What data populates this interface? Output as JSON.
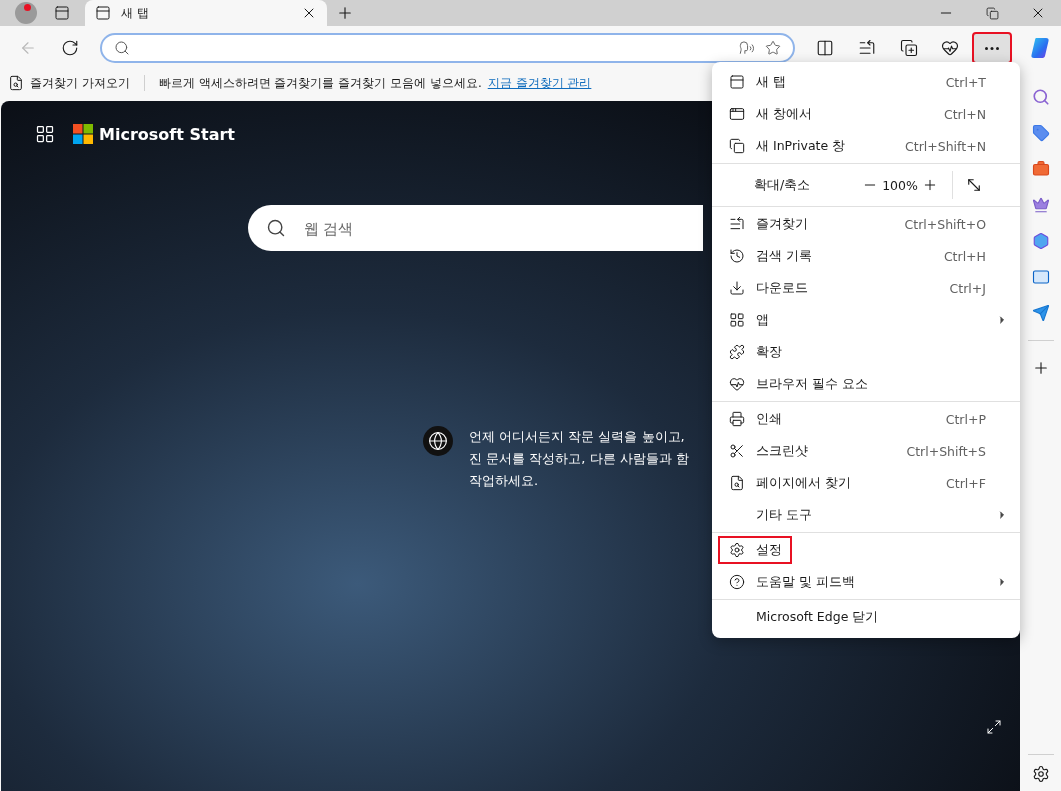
{
  "tabs": [
    {
      "title": "새 탭",
      "selected": true
    }
  ],
  "navigation": {
    "back_disabled": true
  },
  "more_button": {
    "highlighted": true
  },
  "favorites_bar": {
    "import_label": "즐겨찾기 가져오기",
    "message": "빠르게 액세스하려면 즐겨찾기를 즐겨찾기 모음에 넣으세요.",
    "link": "지금 즐겨찾기 관리"
  },
  "start_page": {
    "brand": "Microsoft Start",
    "search_placeholder": "웹 검색",
    "tagline_lines": [
      "언제 어디서든지 작문 실력을 높이고,",
      "진 문서를 작성하고, 다른 사람들과 함",
      "작업하세요."
    ]
  },
  "menu": {
    "groups": [
      [
        {
          "kind": "item",
          "label": "새 탭",
          "shortcut": "Ctrl+T",
          "submenu": false,
          "highlighted": false
        },
        {
          "kind": "item",
          "label": "새 창에서",
          "shortcut": "Ctrl+N",
          "submenu": false,
          "highlighted": false
        },
        {
          "kind": "item",
          "label": "새 InPrivate 창",
          "shortcut": "Ctrl+Shift+N",
          "submenu": false,
          "highlighted": false
        }
      ],
      [
        {
          "kind": "zoom",
          "label": "확대/축소",
          "value": "100%"
        }
      ],
      [
        {
          "kind": "item",
          "label": "즐겨찾기",
          "shortcut": "Ctrl+Shift+O",
          "submenu": false,
          "highlighted": false
        },
        {
          "kind": "item",
          "label": "검색 기록",
          "shortcut": "Ctrl+H",
          "submenu": false,
          "highlighted": false
        },
        {
          "kind": "item",
          "label": "다운로드",
          "shortcut": "Ctrl+J",
          "submenu": false,
          "highlighted": false
        },
        {
          "kind": "item",
          "label": "앱",
          "submenu": true,
          "highlighted": false
        },
        {
          "kind": "item",
          "label": "확장",
          "submenu": false,
          "highlighted": false
        },
        {
          "kind": "item",
          "label": "브라우저 필수 요소",
          "submenu": false,
          "highlighted": false
        }
      ],
      [
        {
          "kind": "item",
          "label": "인쇄",
          "shortcut": "Ctrl+P",
          "submenu": false,
          "highlighted": false
        },
        {
          "kind": "item",
          "label": "스크린샷",
          "shortcut": "Ctrl+Shift+S",
          "submenu": false,
          "highlighted": false
        },
        {
          "kind": "item",
          "label": "페이지에서 찾기",
          "shortcut": "Ctrl+F",
          "submenu": false,
          "highlighted": false
        },
        {
          "kind": "item",
          "label": "기타 도구",
          "submenu": true,
          "highlighted": false
        }
      ],
      [
        {
          "kind": "item",
          "label": "설정",
          "submenu": false,
          "highlighted": true
        },
        {
          "kind": "item",
          "label": "도움말 및 피드백",
          "submenu": true,
          "highlighted": false
        }
      ],
      [
        {
          "kind": "item",
          "label": "Microsoft Edge 닫기",
          "submenu": false,
          "highlighted": false
        }
      ]
    ]
  }
}
